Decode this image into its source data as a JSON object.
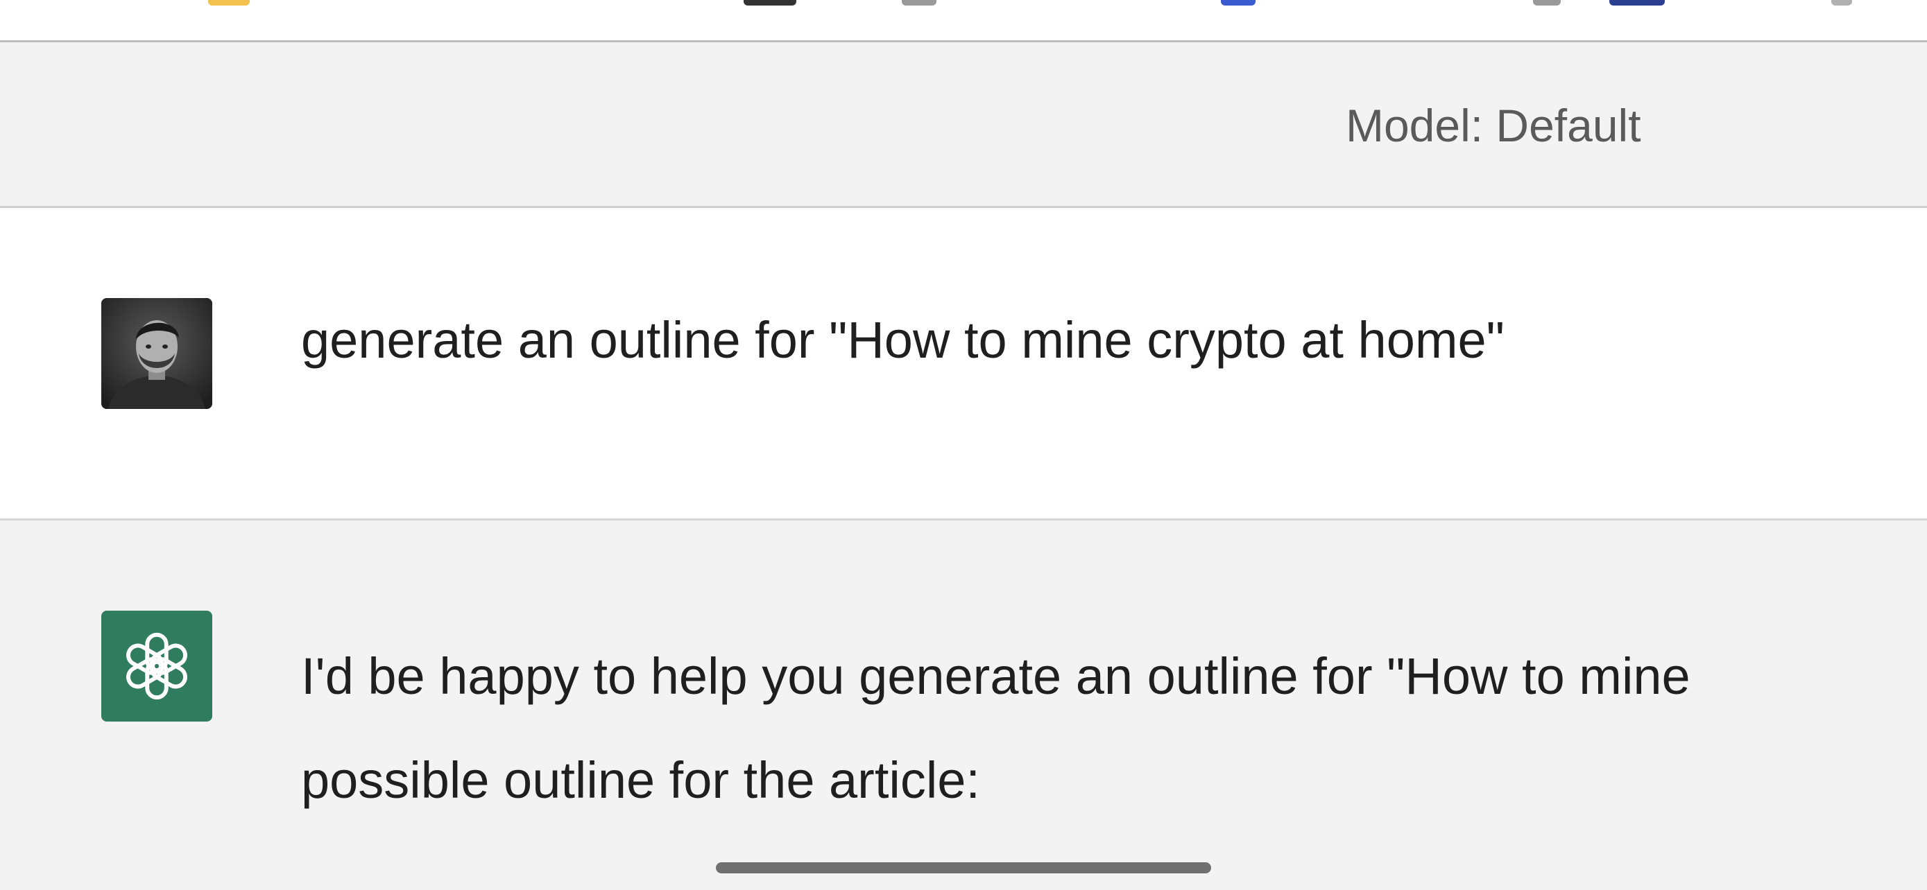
{
  "header": {
    "model_label": "Model: Default"
  },
  "conversation": {
    "user": {
      "avatar": "user-profile-photo",
      "message": "generate an outline for \"How to mine crypto at home\""
    },
    "assistant": {
      "avatar": "openai-logo-icon",
      "message_lines": [
        "I'd be happy to help you generate an outline for \"How to mine",
        "possible outline for the article:"
      ]
    }
  },
  "colors": {
    "assistant_avatar_bg": "#2f7c5e",
    "page_bg": "#f3f3f3",
    "user_row_bg": "#ffffff",
    "text": "#1f1f1f",
    "model_label": "#5a5a5a"
  }
}
